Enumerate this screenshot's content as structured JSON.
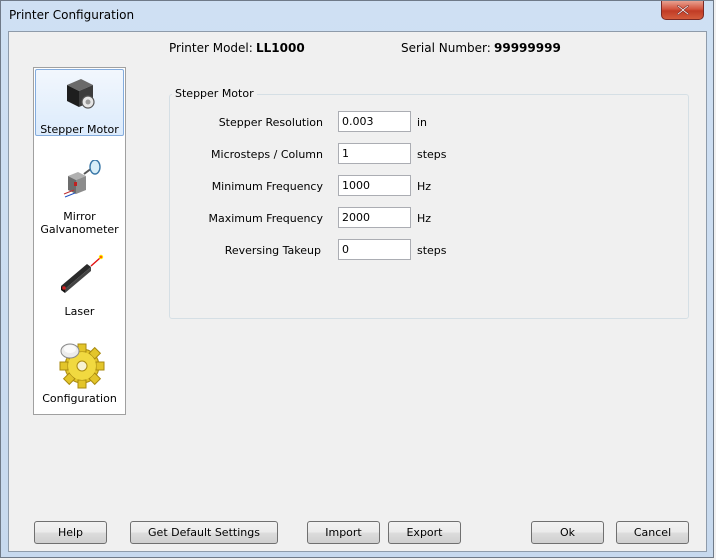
{
  "window": {
    "title": "Printer Configuration",
    "close_icon": "close-icon"
  },
  "header": {
    "model_label": "Printer Model:",
    "model_value": "LL1000",
    "serial_label": "Serial Number:",
    "serial_value": "99999999"
  },
  "sidebar": {
    "selected": "Stepper Motor",
    "items": [
      {
        "label": "Stepper Motor",
        "icon": "stepper-motor-icon"
      },
      {
        "label": "Mirror\nGalvanometer",
        "icon": "mirror-galvanometer-icon"
      },
      {
        "label": "Laser",
        "icon": "laser-icon"
      },
      {
        "label": "Configuration",
        "icon": "configuration-gear-icon"
      }
    ]
  },
  "panel": {
    "title": "Stepper Motor",
    "fields": [
      {
        "label": "Stepper Resolution",
        "value": "0.003",
        "unit": "in"
      },
      {
        "label": "Microsteps / Column",
        "value": "1",
        "unit": "steps"
      },
      {
        "label": "Minimum Frequency",
        "value": "1000",
        "unit": "Hz"
      },
      {
        "label": "Maximum Frequency",
        "value": "2000",
        "unit": "Hz"
      },
      {
        "label": "Reversing Takeup",
        "value": "0",
        "unit": "steps"
      }
    ]
  },
  "buttons": {
    "help": "Help",
    "default": "Get Default Settings",
    "import": "Import",
    "export": "Export",
    "ok": "Ok",
    "cancel": "Cancel"
  }
}
